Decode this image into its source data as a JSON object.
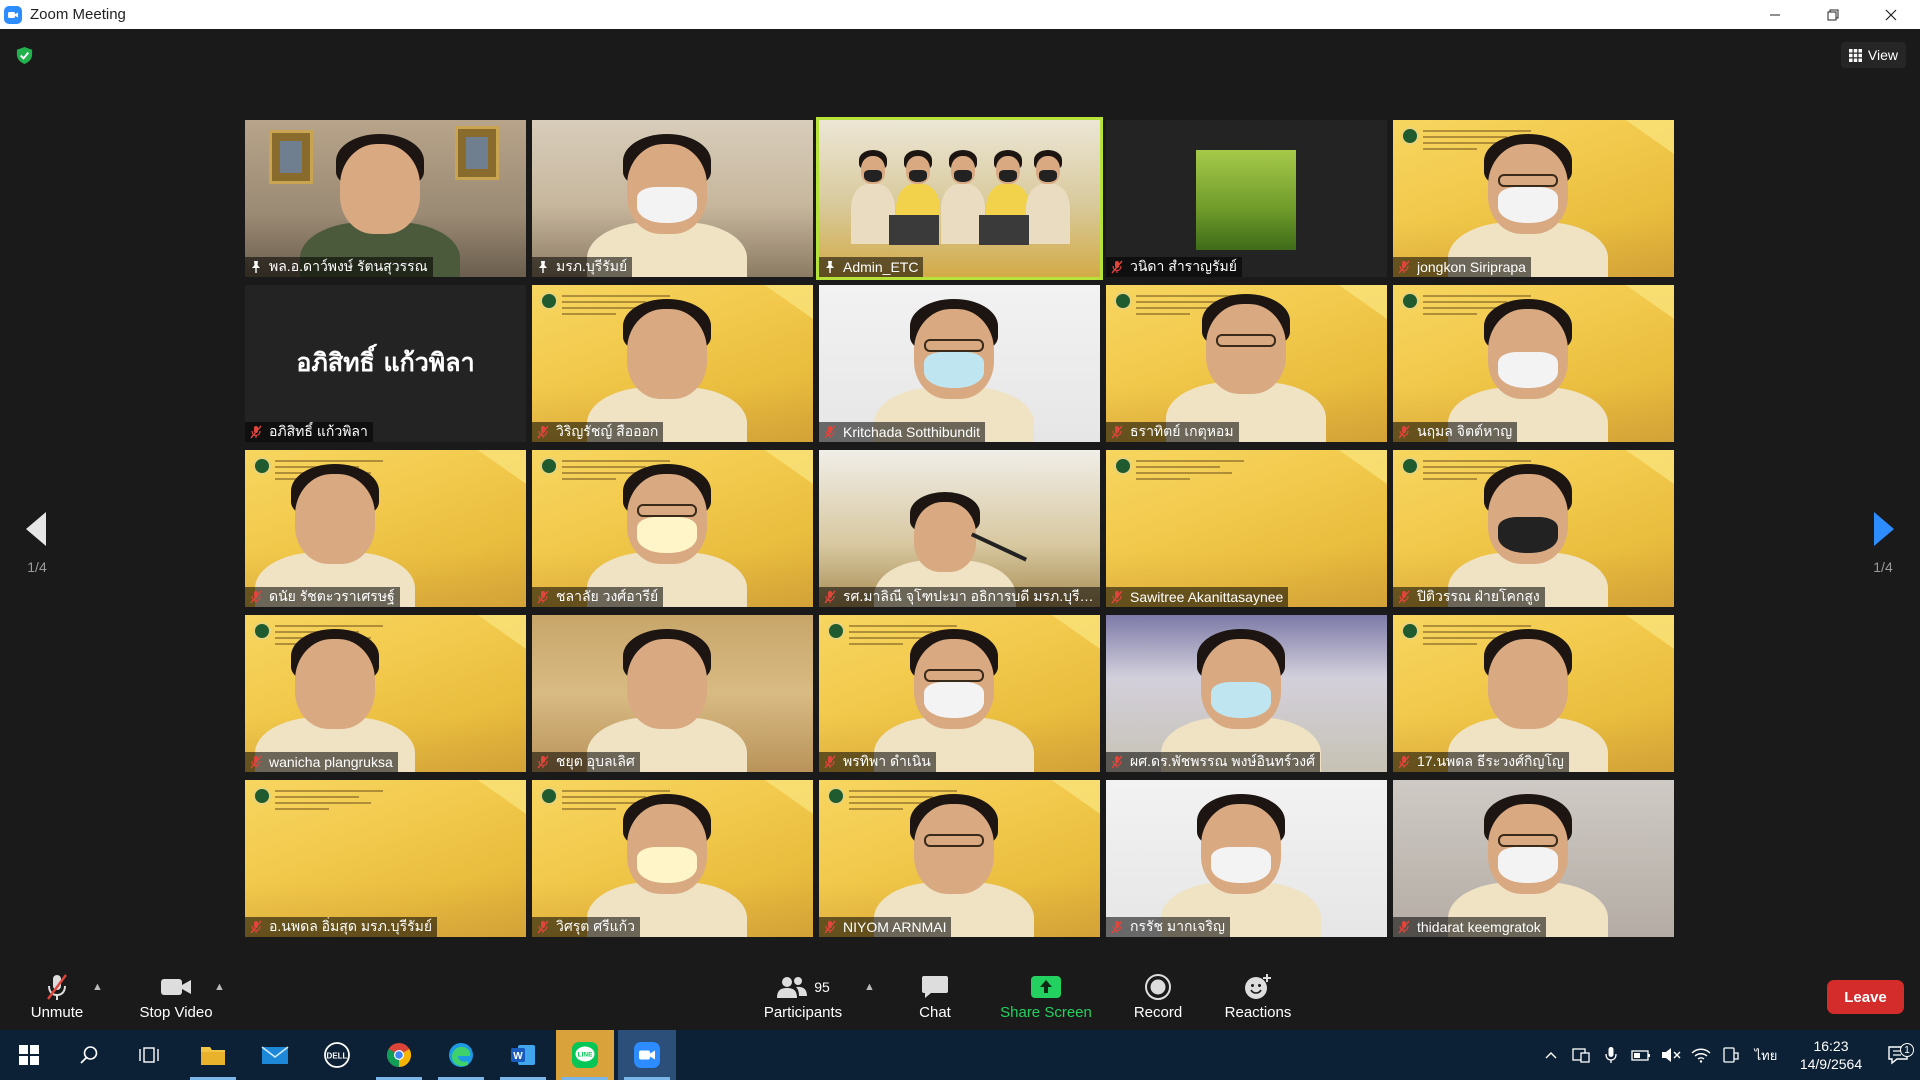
{
  "window": {
    "title": "Zoom Meeting"
  },
  "meeting": {
    "view_label": "View",
    "page_left": "1/4",
    "page_right": "1/4",
    "participants": [
      {
        "name": "พล.อ.ดาว์พงษ์ รัตนสุวรรณ",
        "status": "pinned",
        "bg": "room",
        "person": "man-uniform",
        "active": false
      },
      {
        "name": "มรภ.บุรีรัมย์",
        "status": "pinned",
        "bg": "room2",
        "person": "woman-mask",
        "active": false
      },
      {
        "name": "Admin_ETC",
        "status": "pinned",
        "bg": "stage",
        "person": "group",
        "active": true
      },
      {
        "name": "วนิดา สำราญรัมย์",
        "status": "muted",
        "bg": "plain",
        "person": "rice",
        "active": false
      },
      {
        "name": "jongkon Siriprapa",
        "status": "muted",
        "bg": "yellow",
        "person": "woman-glasses-mask",
        "active": false
      },
      {
        "name": "อภิสิทธิ์ แก้วพิลา",
        "status": "muted",
        "bg": "plain",
        "person": "none",
        "big_name": "อภิสิทธิ์ แก้วพิลา",
        "active": false
      },
      {
        "name": "วิริญรัชญ์ สือออก",
        "status": "muted",
        "bg": "yellow",
        "person": "woman",
        "active": false
      },
      {
        "name": "Kritchada Sotthibundit",
        "status": "muted",
        "bg": "white",
        "person": "woman-glasses-mask-light",
        "active": false
      },
      {
        "name": "ธราทิตย์ เกตุหอม",
        "status": "muted",
        "bg": "yellow",
        "person": "man-glasses-down",
        "active": false
      },
      {
        "name": "นฤมล จิตต์หาญ",
        "status": "muted",
        "bg": "yellow",
        "person": "woman-mask",
        "active": false
      },
      {
        "name": "ดนัย รัชตะวราเศรษฐ์",
        "status": "muted",
        "bg": "yellow",
        "person": "man-side",
        "active": false
      },
      {
        "name": "ชลาลัย วงศ์อารีย์",
        "status": "muted",
        "bg": "yellow",
        "person": "woman-glasses-mask-yellow",
        "active": false
      },
      {
        "name": "รศ.มาลิณี จุโฑปะมา อธิการบดี มรภ.บุรีรัมย์",
        "status": "muted",
        "bg": "event",
        "person": "woman-mic",
        "active": false
      },
      {
        "name": "Sawitree Akanittasaynee",
        "status": "muted",
        "bg": "yellow",
        "person": "none",
        "active": false
      },
      {
        "name": "ปิติวรรณ ฝ่ายโคกสูง",
        "status": "muted",
        "bg": "yellow",
        "person": "woman-mask-black",
        "active": false
      },
      {
        "name": "wanicha plangruksa",
        "status": "muted",
        "bg": "yellow",
        "person": "woman-side",
        "active": false
      },
      {
        "name": "ชยุต อุบลเลิศ",
        "status": "muted",
        "bg": "shelf",
        "person": "man-hand",
        "active": false
      },
      {
        "name": "พรทิพา ดำเนิน",
        "status": "muted",
        "bg": "yellow",
        "person": "woman-glasses-mask",
        "active": false
      },
      {
        "name": "ผศ.ดร.พัชพรรณ พงษ์อินทร์วงศ์",
        "status": "muted",
        "bg": "office",
        "person": "woman-mask-blue",
        "active": false
      },
      {
        "name": "17.นพดล ธีระวงศ์กิญโญ",
        "status": "muted",
        "bg": "yellow",
        "person": "man-smile",
        "active": false
      },
      {
        "name": "อ.นพดล อิ่มสุด มรภ.บุรีรัมย์",
        "status": "muted",
        "bg": "yellow",
        "person": "none",
        "active": false
      },
      {
        "name": "วิศรุต ศรีแก้ว",
        "status": "muted",
        "bg": "yellow",
        "person": "man-mask-yellow",
        "active": false
      },
      {
        "name": "NIYOM ARNMAI",
        "status": "muted",
        "bg": "yellow",
        "person": "man-glasses",
        "active": false
      },
      {
        "name": "กรรัช มากเจริญ",
        "status": "muted",
        "bg": "white",
        "person": "man-mask-white",
        "active": false
      },
      {
        "name": "thidarat keemgratok",
        "status": "muted",
        "bg": "room3",
        "person": "woman-glasses-mask-2",
        "active": false
      }
    ]
  },
  "toolbar": {
    "unmute_label": "Unmute",
    "stop_video_label": "Stop Video",
    "participants_label": "Participants",
    "participants_count": "95",
    "chat_label": "Chat",
    "share_label": "Share Screen",
    "record_label": "Record",
    "reactions_label": "Reactions",
    "leave_label": "Leave"
  },
  "taskbar": {
    "lang": "ไทย",
    "time": "16:23",
    "date": "14/9/2564",
    "notif_count": "1"
  },
  "colors": {
    "accent_active": "#b6e23a",
    "leave": "#d42b2b",
    "share": "#23d160",
    "muted_icon": "#e0453c"
  }
}
